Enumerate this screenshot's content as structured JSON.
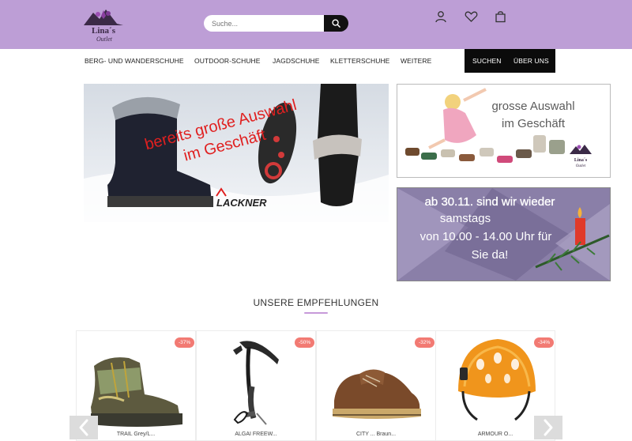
{
  "header": {
    "logo_text_line1": "Lina´s",
    "logo_text_line2": "Outlet",
    "search_placeholder": "Suche...",
    "icons": [
      "search-icon",
      "user-icon",
      "heart-icon",
      "bag-icon"
    ]
  },
  "nav": {
    "items": [
      "BERG- UND WANDERSCHUHE",
      "OUTDOOR-SCHUHE",
      "JAGDSCHUHE",
      "KLETTERSCHUHE",
      "WEITERE"
    ],
    "search_label": "SUCHEN",
    "about_label": "ÜBER UNS"
  },
  "banners": {
    "main_text_line1": "bereits große Auswahl",
    "main_text_line2": "im Geschäft",
    "main_brand": "LACKNER",
    "side1_text_line1": "grosse Auswahl",
    "side1_text_line2": "im Geschäft",
    "side2_text_line1": "ab 30.11. sind wir wieder",
    "side2_text_line2": "samstags",
    "side2_text_line3": "von 10.00 - 14.00 Uhr für",
    "side2_text_line4": "Sie da!"
  },
  "recommendations": {
    "title": "UNSERE EMPFEHLUNGEN",
    "products": [
      {
        "badge": "-37%",
        "name": "TRAIL Grey/L..."
      },
      {
        "badge": "-50%",
        "name": "ALGAI FREEW..."
      },
      {
        "badge": "-32%",
        "name": "CITY ... Braun..."
      },
      {
        "badge": "-34%",
        "name": "ARMOUR O..."
      }
    ]
  },
  "colors": {
    "header_bg": "#bd9ed6",
    "accent": "#c79ad9",
    "badge": "#f27a73",
    "dark": "#0b0b0b"
  }
}
